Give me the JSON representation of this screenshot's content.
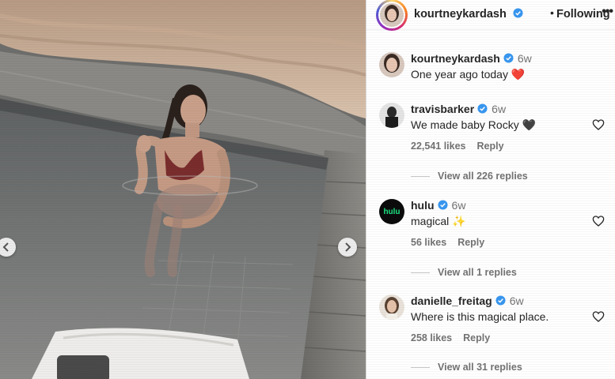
{
  "post": {
    "author": "kourtneykardash",
    "follow_status": "Following",
    "separator": "•",
    "more_label": "•••"
  },
  "caption": {
    "username": "kourtneykardash",
    "time": "6w",
    "text": "One year ago today ❤️"
  },
  "comments": [
    {
      "username": "travisbarker",
      "time": "6w",
      "text": "We made baby Rocky 🖤",
      "likes": "22,541 likes",
      "reply_label": "Reply",
      "view_replies": "View all 226 replies"
    },
    {
      "username": "hulu",
      "time": "6w",
      "text": "magical ✨",
      "likes": "56 likes",
      "reply_label": "Reply",
      "view_replies": "View all 1 replies",
      "avatar_text": "hulu"
    },
    {
      "username": "danielle_freitag",
      "time": "6w",
      "text": "Where is this magical place.",
      "likes": "258 likes",
      "reply_label": "Reply",
      "view_replies": "View all 31 replies"
    }
  ],
  "icons": {
    "verified": "verified-badge-icon",
    "like": "heart-outline-icon",
    "prev": "chevron-left-icon",
    "next": "chevron-right-icon"
  },
  "colors": {
    "verified_blue": "#3897f0",
    "hulu_green": "#1ce783",
    "text_primary": "#262626",
    "text_secondary": "#737373"
  }
}
